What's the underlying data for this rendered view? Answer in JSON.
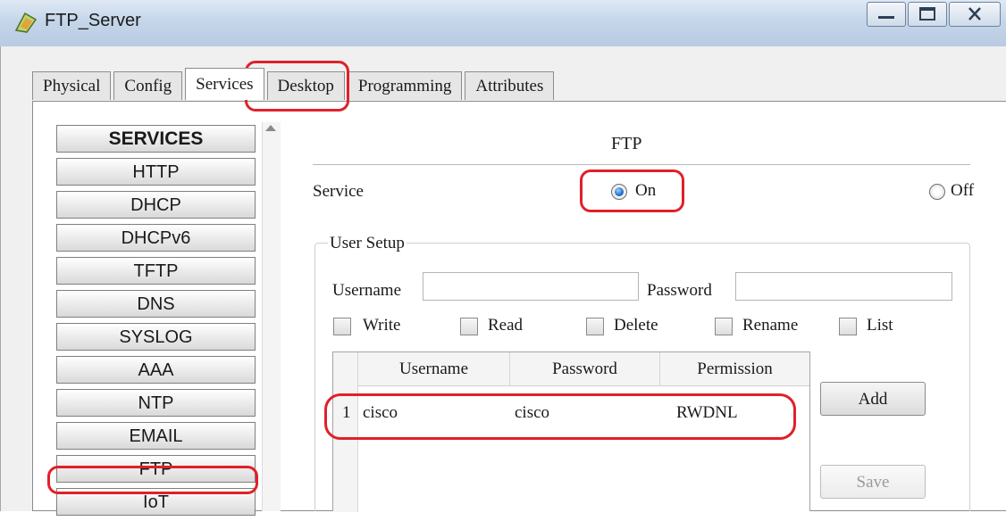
{
  "window": {
    "title": "FTP_Server"
  },
  "tabs": [
    {
      "label": "Physical",
      "active": false
    },
    {
      "label": "Config",
      "active": false
    },
    {
      "label": "Services",
      "active": true
    },
    {
      "label": "Desktop",
      "active": false
    },
    {
      "label": "Programming",
      "active": false
    },
    {
      "label": "Attributes",
      "active": false
    }
  ],
  "sidebar": {
    "header": "SERVICES",
    "items": [
      "HTTP",
      "DHCP",
      "DHCPv6",
      "TFTP",
      "DNS",
      "SYSLOG",
      "AAA",
      "NTP",
      "EMAIL",
      "FTP",
      "IoT"
    ]
  },
  "ftp": {
    "title": "FTP",
    "service_label": "Service",
    "on_label": "On",
    "off_label": "Off",
    "selected": "On",
    "user_setup": {
      "legend": "User Setup",
      "username_label": "Username",
      "password_label": "Password",
      "username_value": "",
      "password_value": "",
      "permissions": [
        "Write",
        "Read",
        "Delete",
        "Rename",
        "List"
      ]
    },
    "table": {
      "columns": [
        "Username",
        "Password",
        "Permission"
      ],
      "rows": [
        {
          "index": "1",
          "username": "cisco",
          "password": "cisco",
          "permission": "RWDNL"
        }
      ]
    },
    "add_button": "Add",
    "save_button": "Save"
  },
  "colors": {
    "highlight": "#e0202a",
    "titlebar": "#c5d6ea"
  }
}
